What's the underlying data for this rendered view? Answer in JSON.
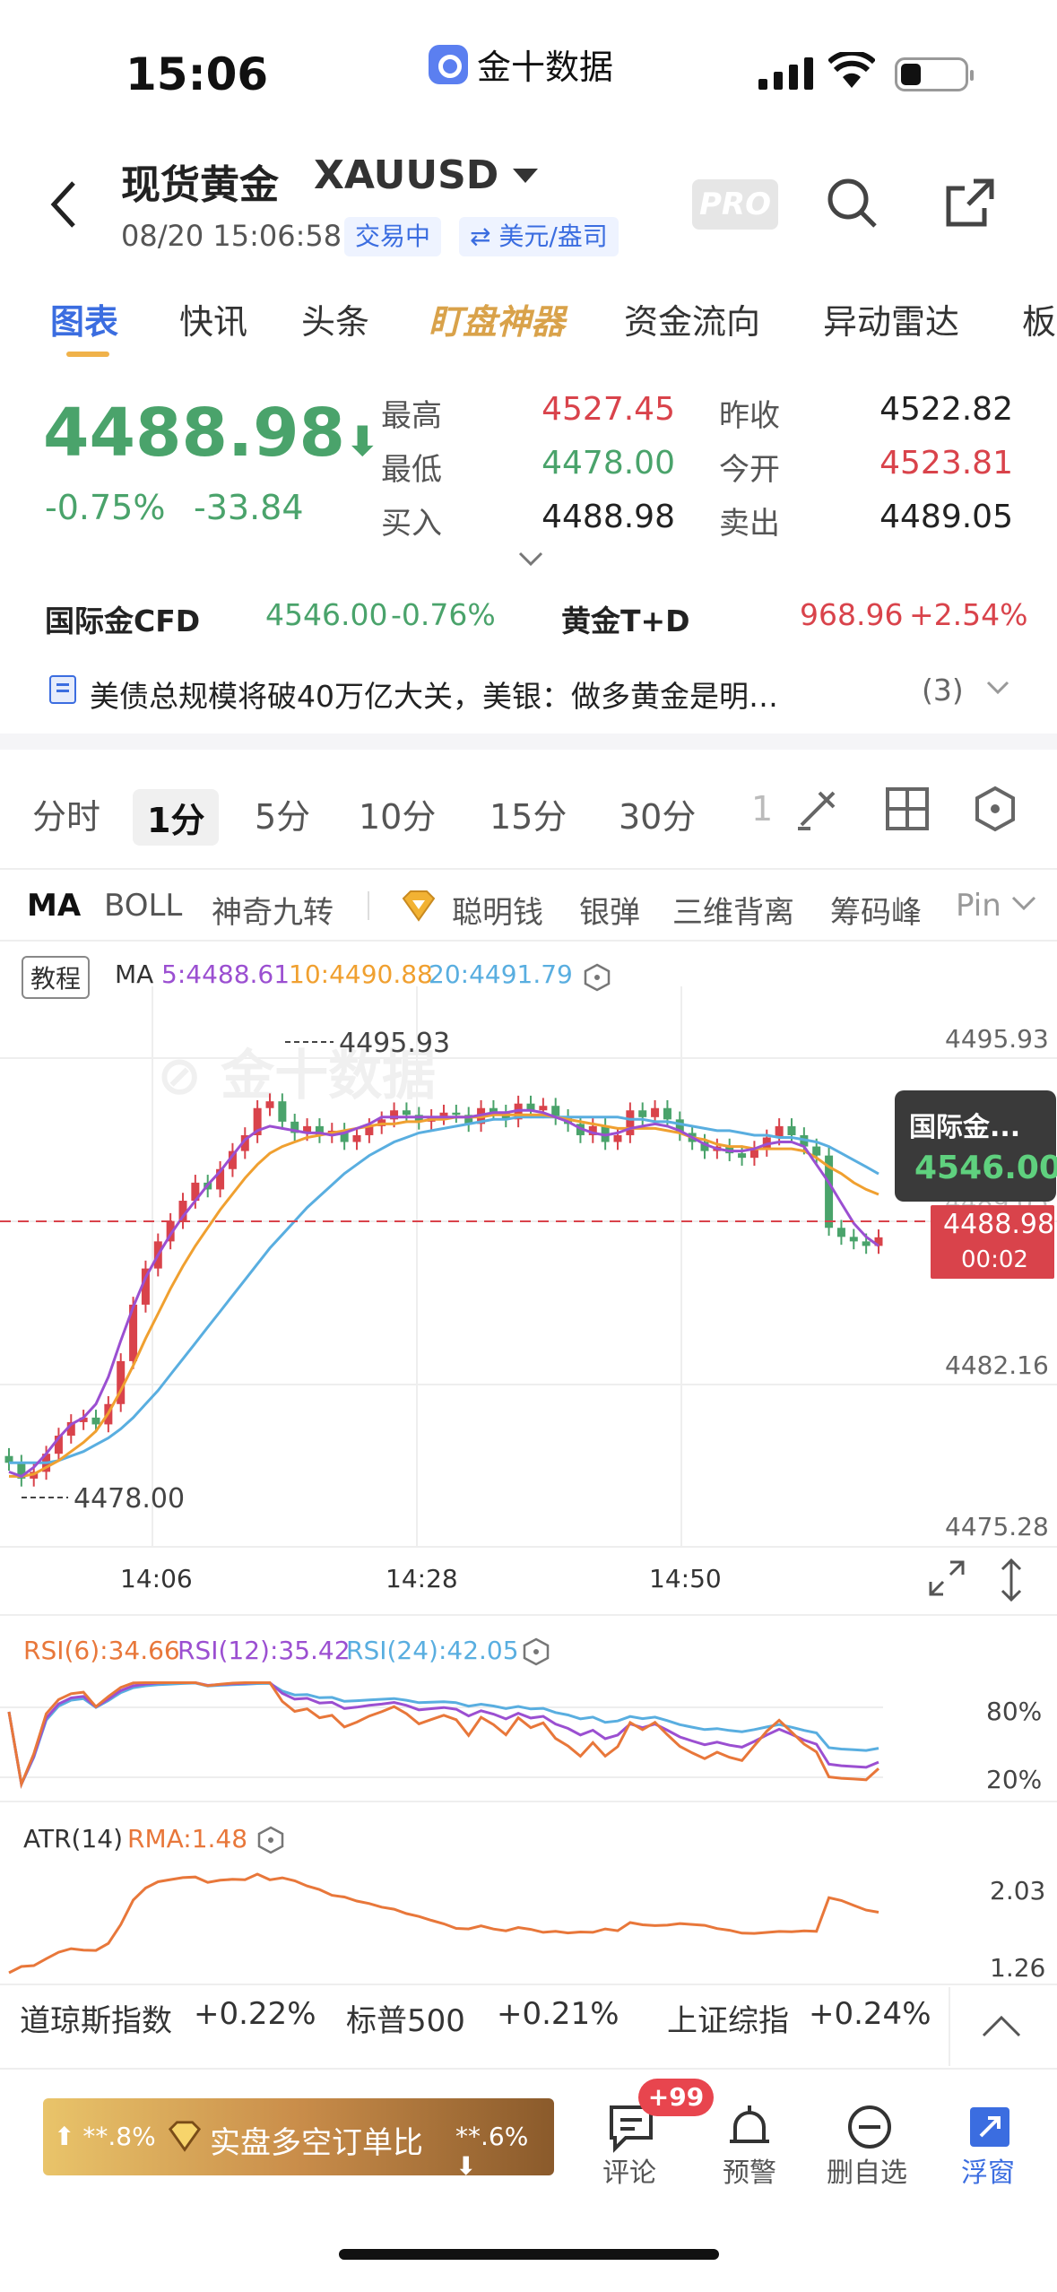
{
  "status": {
    "time": "15:06",
    "app": "金十数据"
  },
  "header": {
    "title": "现货黄金",
    "symbol": "XAUUSD",
    "datetime": "08/20 15:06:58",
    "trading": "交易中",
    "currency": "⇄ 美元/盎司",
    "pro": "PRO"
  },
  "tabs": [
    "图表",
    "快讯",
    "头条",
    "盯盘神器",
    "资金流向",
    "异动雷达",
    "板"
  ],
  "quote": {
    "price": "4488.98",
    "arrow": "⬇",
    "pct": "-0.75%",
    "chg": "-33.84",
    "high_l": "最高",
    "high": "4527.45",
    "prev_l": "昨收",
    "prev": "4522.82",
    "low_l": "最低",
    "low": "4478.00",
    "open_l": "今开",
    "open": "4523.81",
    "buy_l": "买入",
    "buy": "4488.98",
    "sell_l": "卖出",
    "sell": "4489.05"
  },
  "related": {
    "cfd_l": "国际金CFD",
    "cfd": "4546.00",
    "cfd_pct": "-0.76%",
    "td_l": "黄金T+D",
    "td": "968.96",
    "td_pct": "+2.54%"
  },
  "news": {
    "text": "美债总规模将破40万亿大关，美银：做多黄金是明…",
    "count": "(3)"
  },
  "intervals": [
    "分时",
    "1分",
    "5分",
    "10分",
    "15分",
    "30分",
    "1"
  ],
  "indicators": [
    "MA",
    "BOLL",
    "神奇九转",
    "聪明钱",
    "银弹",
    "三维背离",
    "筹码峰",
    "Pin"
  ],
  "chart_data": {
    "type": "candlestick",
    "legend": {
      "tutorial": "教程",
      "ma": "MA",
      "ma5": "5:4488.61",
      "ma10": "10:4490.88",
      "ma20": "20:4491.79"
    },
    "yticks": [
      "4495.93",
      "4489.05",
      "4482.16",
      "4475.28"
    ],
    "xticks": [
      "14:06",
      "14:28",
      "14:50"
    ],
    "high_label": "4495.93",
    "low_label": "4478.00",
    "current": {
      "label": "4488.98",
      "timer": "00:02"
    },
    "tooltip": {
      "name": "国际金...",
      "value": "4546.00"
    },
    "ylim": [
      4475.28,
      4498.5
    ],
    "closes": [
      4479.0,
      4478.3,
      4478.6,
      4479.4,
      4480.2,
      4480.8,
      4481.0,
      4480.7,
      4481.6,
      4483.5,
      4486.0,
      4487.6,
      4488.8,
      4489.7,
      4490.6,
      4491.4,
      4491.1,
      4492.0,
      4492.8,
      4493.5,
      4494.7,
      4495.0,
      4494.1,
      4493.6,
      4493.9,
      4493.5,
      4493.7,
      4493.2,
      4493.5,
      4493.9,
      4494.2,
      4494.6,
      4494.4,
      4494.1,
      4494.3,
      4494.5,
      4494.4,
      4494.0,
      4494.7,
      4494.5,
      4494.2,
      4494.9,
      4494.6,
      4494.8,
      4494.3,
      4494.0,
      4493.5,
      4493.9,
      4493.2,
      4493.5,
      4494.6,
      4494.3,
      4494.7,
      4494.2,
      4493.6,
      4493.2,
      4492.8,
      4493.0,
      4492.7,
      4492.5,
      4492.9,
      4493.4,
      4493.9,
      4493.5,
      4493.0,
      4492.6,
      4489.4,
      4489.0,
      4488.8,
      4488.6,
      4488.98
    ],
    "ma5": [
      4478.6,
      4478.4,
      4478.8,
      4479.4,
      4480.1,
      4480.7,
      4481.0,
      4481.6,
      4482.8,
      4484.4,
      4485.9,
      4487.2,
      4488.2,
      4489.1,
      4489.9,
      4490.6,
      4491.3,
      4491.9,
      4492.6,
      4493.3,
      4493.7,
      4493.9,
      4493.8,
      4493.7,
      4493.6,
      4493.6,
      4493.5,
      4493.6,
      4493.8,
      4494.0,
      4494.3,
      4494.3,
      4494.3,
      4494.3,
      4494.3,
      4494.3,
      4494.3,
      4494.3,
      4494.4,
      4494.5,
      4494.5,
      4494.6,
      4494.6,
      4494.5,
      4494.3,
      4494.1,
      4493.8,
      4493.6,
      4493.5,
      4493.6,
      4493.8,
      4493.9,
      4494.0,
      4493.9,
      4493.7,
      4493.4,
      4493.1,
      4492.9,
      4492.8,
      4492.8,
      4492.9,
      4493.1,
      4493.2,
      4493.2,
      4493.0,
      4492.2,
      4491.4,
      4490.5,
      4489.6,
      4489.0,
      4488.6
    ],
    "ma10": [
      4478.4,
      4478.4,
      4478.5,
      4478.8,
      4479.1,
      4479.5,
      4479.9,
      4480.4,
      4481.2,
      4482.2,
      4483.3,
      4484.5,
      4485.6,
      4486.7,
      4487.7,
      4488.6,
      4489.4,
      4490.2,
      4490.9,
      4491.6,
      4492.2,
      4492.7,
      4493.0,
      4493.2,
      4493.4,
      4493.5,
      4493.6,
      4493.7,
      4493.8,
      4493.9,
      4494.0,
      4494.0,
      4494.1,
      4494.1,
      4494.2,
      4494.2,
      4494.3,
      4494.3,
      4494.3,
      4494.4,
      4494.4,
      4494.4,
      4494.4,
      4494.4,
      4494.3,
      4494.2,
      4494.1,
      4494.0,
      4493.9,
      4493.8,
      4493.8,
      4493.8,
      4493.8,
      4493.7,
      4493.6,
      4493.4,
      4493.3,
      4493.1,
      4493.0,
      4493.0,
      4492.9,
      4492.9,
      4492.9,
      4492.9,
      4492.8,
      4492.5,
      4492.1,
      4491.8,
      4491.4,
      4491.1,
      4490.88
    ],
    "ma20": [
      4479.0,
      4479.0,
      4479.0,
      4479.0,
      4479.1,
      4479.3,
      4479.5,
      4479.8,
      4480.1,
      4480.5,
      4481.0,
      4481.6,
      4482.2,
      4482.9,
      4483.6,
      4484.3,
      4485.0,
      4485.7,
      4486.4,
      4487.1,
      4487.8,
      4488.5,
      4489.1,
      4489.7,
      4490.3,
      4490.8,
      4491.3,
      4491.8,
      4492.2,
      4492.6,
      4492.9,
      4493.2,
      4493.4,
      4493.6,
      4493.7,
      4493.8,
      4493.9,
      4494.0,
      4494.1,
      4494.2,
      4494.2,
      4494.3,
      4494.3,
      4494.3,
      4494.3,
      4494.3,
      4494.3,
      4494.3,
      4494.3,
      4494.3,
      4494.2,
      4494.2,
      4494.1,
      4494.1,
      4494.0,
      4493.9,
      4493.8,
      4493.7,
      4493.7,
      4493.6,
      4493.5,
      4493.5,
      4493.4,
      4493.4,
      4493.3,
      4493.2,
      4493.0,
      4492.7,
      4492.4,
      4492.1,
      4491.79
    ],
    "rsi": {
      "label6": "RSI(6):34.66",
      "label12": "RSI(12):35.42",
      "label24": "RSI(24):42.05",
      "ticks": [
        "80%",
        "20%"
      ]
    },
    "atr": {
      "label": "ATR(14)",
      "rma": "RMA:1.48",
      "ticks": [
        "2.03",
        "1.26"
      ]
    }
  },
  "tickers": [
    {
      "name": "道琼斯指数",
      "val": "+0.22%"
    },
    {
      "name": "标普500",
      "val": "+0.21%"
    },
    {
      "name": "上证综指",
      "val": "+0.24%"
    }
  ],
  "bottom": {
    "left_pct": "⬆ **.8%",
    "banner": "实盘多空订单比",
    "right_pct": "**.6% ⬇",
    "badge": "+99",
    "comment": "评论",
    "alert": "预警",
    "remove": "删自选",
    "float": "浮窗"
  },
  "colors": {
    "up": "#d9434b",
    "down": "#4aa36b",
    "accent": "#3b6de0",
    "ma5": "#9b4fd1",
    "ma10": "#f0a030",
    "ma20": "#59aee0"
  }
}
